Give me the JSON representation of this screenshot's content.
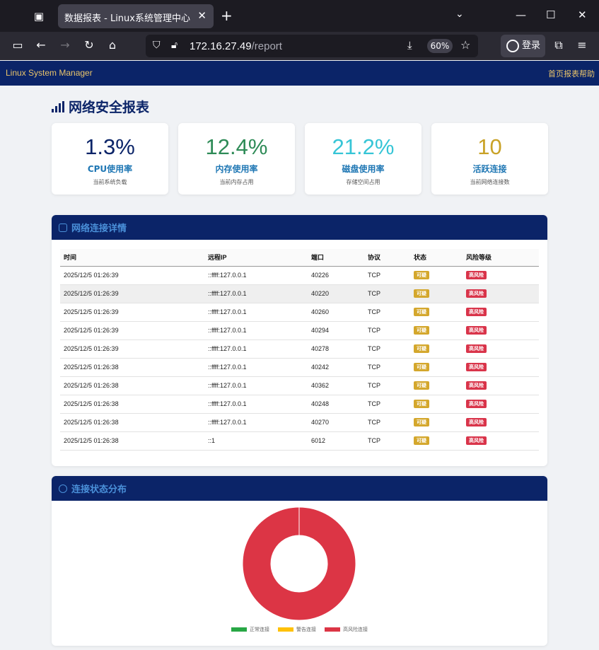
{
  "browser": {
    "tab_title": "数据报表 - Linux系统管理中心",
    "url_host": "172.16.27.49",
    "url_path": "/report",
    "zoom": "60%",
    "login": "登录"
  },
  "app": {
    "brand": "Linux System Manager",
    "nav": [
      "首页",
      "报表",
      "帮助"
    ]
  },
  "page": {
    "title": "网络安全报表"
  },
  "stats": [
    {
      "value": "1.3%",
      "label": "CPU使用率",
      "sub": "当前系统负载",
      "color": "#0b2468"
    },
    {
      "value": "12.4%",
      "label": "内存使用率",
      "sub": "当前内存占用",
      "color": "#2e8b57"
    },
    {
      "value": "21.2%",
      "label": "磁盘使用率",
      "sub": "存储空间占用",
      "color": "#36c5d6"
    },
    {
      "value": "10",
      "label": "活跃连接",
      "sub": "当前网络连接数",
      "color": "#c9a227"
    }
  ],
  "connections": {
    "title": "网络连接详情",
    "headers": [
      "时间",
      "远程IP",
      "端口",
      "协议",
      "状态",
      "风险等级"
    ],
    "rows": [
      {
        "time": "2025/12/5 01:26:39",
        "ip": "::ffff:127.0.0.1",
        "port": "40226",
        "proto": "TCP",
        "status": "可疑",
        "risk": "高风险"
      },
      {
        "time": "2025/12/5 01:26:39",
        "ip": "::ffff:127.0.0.1",
        "port": "40220",
        "proto": "TCP",
        "status": "可疑",
        "risk": "高风险"
      },
      {
        "time": "2025/12/5 01:26:39",
        "ip": "::ffff:127.0.0.1",
        "port": "40260",
        "proto": "TCP",
        "status": "可疑",
        "risk": "高风险"
      },
      {
        "time": "2025/12/5 01:26:39",
        "ip": "::ffff:127.0.0.1",
        "port": "40294",
        "proto": "TCP",
        "status": "可疑",
        "risk": "高风险"
      },
      {
        "time": "2025/12/5 01:26:39",
        "ip": "::ffff:127.0.0.1",
        "port": "40278",
        "proto": "TCP",
        "status": "可疑",
        "risk": "高风险"
      },
      {
        "time": "2025/12/5 01:26:38",
        "ip": "::ffff:127.0.0.1",
        "port": "40242",
        "proto": "TCP",
        "status": "可疑",
        "risk": "高风险"
      },
      {
        "time": "2025/12/5 01:26:38",
        "ip": "::ffff:127.0.0.1",
        "port": "40362",
        "proto": "TCP",
        "status": "可疑",
        "risk": "高风险"
      },
      {
        "time": "2025/12/5 01:26:38",
        "ip": "::ffff:127.0.0.1",
        "port": "40248",
        "proto": "TCP",
        "status": "可疑",
        "risk": "高风险"
      },
      {
        "time": "2025/12/5 01:26:38",
        "ip": "::ffff:127.0.0.1",
        "port": "40270",
        "proto": "TCP",
        "status": "可疑",
        "risk": "高风险"
      },
      {
        "time": "2025/12/5 01:26:38",
        "ip": "::1",
        "port": "6012",
        "proto": "TCP",
        "status": "可疑",
        "risk": "高风险"
      }
    ]
  },
  "distribution": {
    "title": "连接状态分布"
  },
  "chart_data": {
    "type": "pie",
    "categories": [
      "正常连接",
      "警告连接",
      "高风险连接"
    ],
    "values": [
      0,
      0,
      10
    ],
    "colors": [
      "#28a745",
      "#ffc107",
      "#dc3545"
    ],
    "donut": true,
    "legend": "bottom"
  }
}
